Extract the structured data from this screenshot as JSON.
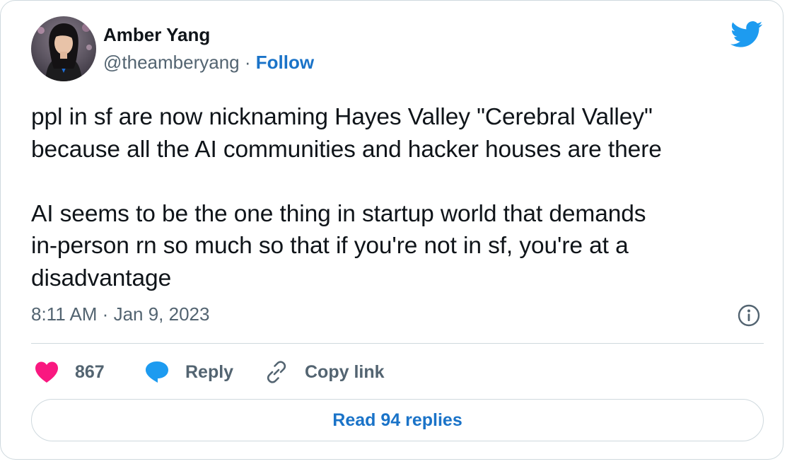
{
  "author": {
    "name": "Amber Yang",
    "handle": "@theamberyang",
    "separator": "·",
    "follow_label": "Follow",
    "avatar_icon": "profile-photo"
  },
  "brand": {
    "icon": "twitter-bird-icon",
    "color": "#1d9bf0"
  },
  "tweet": {
    "text": "ppl in sf are now nicknaming Hayes Valley \"Cerebral Valley\"\nbecause all the AI communities and hacker houses are there\n\nAI seems to be the one thing in startup world that demands\nin-person rn so much so that if you're not in sf, you're at a\ndisadvantage",
    "timestamp": "8:11 AM · Jan 9, 2023"
  },
  "actions": {
    "like_count": "867",
    "like_icon": "heart-icon",
    "like_color": "#f91880",
    "reply_label": "Reply",
    "reply_icon": "speech-bubble-icon",
    "copy_label": "Copy link",
    "copy_icon": "link-icon",
    "info_icon": "info-icon"
  },
  "footer": {
    "read_replies_label": "Read 94 replies"
  },
  "colors": {
    "link": "#1a73c8",
    "text": "#0f1419",
    "muted": "#536471",
    "border": "#cfd9de"
  }
}
